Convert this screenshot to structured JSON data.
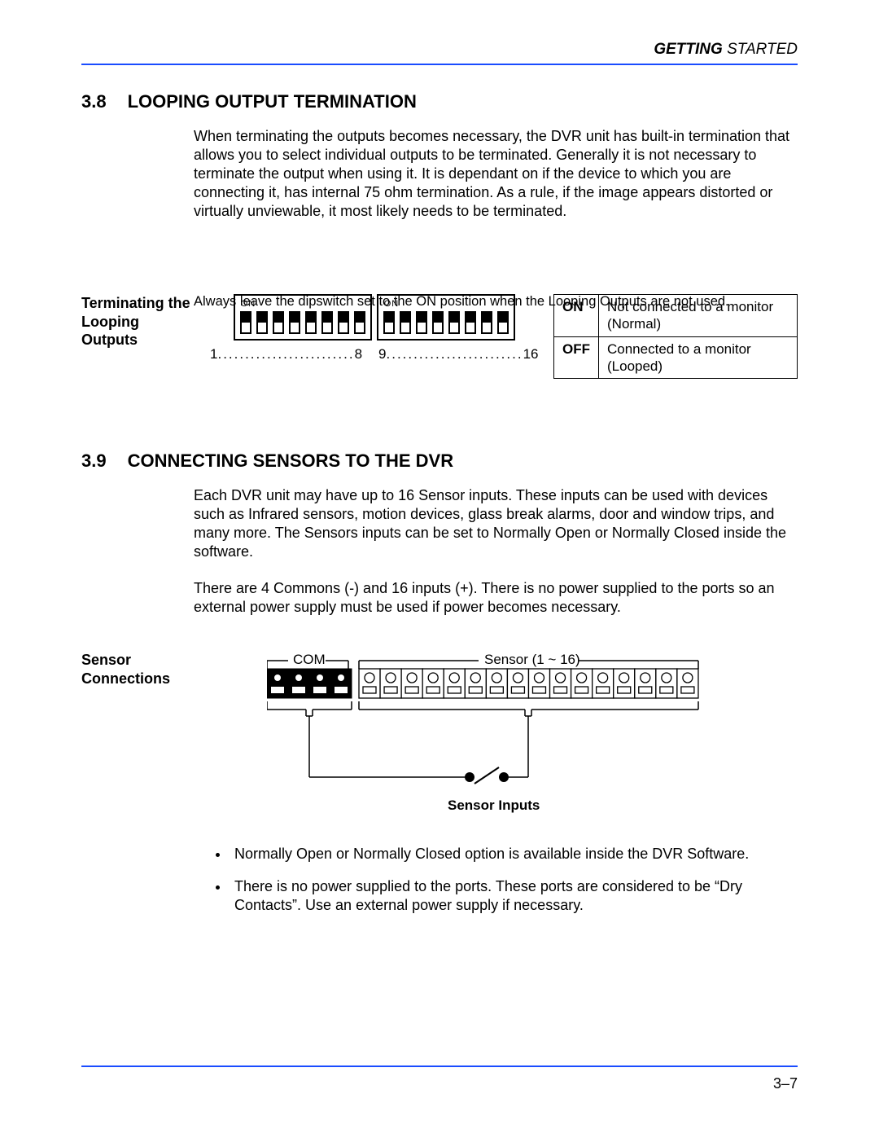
{
  "header": {
    "getting": "GETTING",
    "started": " STARTED"
  },
  "s38": {
    "num": "3.8",
    "title": "LOOPING OUTPUT TERMINATION",
    "body": "When terminating the outputs becomes necessary, the DVR unit has built-in termination that allows you to select individual outputs to be terminated. Generally it is not necessary to terminate the output when using it. It is dependant on if the device to which you are connecting it, has internal 75 ohm termination. As a rule, if the image appears distorted or virtually unviewable, it most likely needs to be terminated.",
    "side_label": "Terminating the Looping Outputs",
    "on_label": "ON",
    "range1_start": "1",
    "range1_end": "8",
    "range2_start": "9",
    "range2_end": "16",
    "table": {
      "on": "ON",
      "on_desc": "Not connected to a monitor (Normal)",
      "off": "OFF",
      "off_desc": "Connected to a monitor (Looped)"
    },
    "note": "Always leave the dipswitch set to the ON position when the Looping Outputs are not used."
  },
  "s39": {
    "num": "3.9",
    "title": "CONNECTING SENSORS TO THE DVR",
    "body1": "Each DVR unit may have up to 16 Sensor inputs. These inputs can be used with devices such as Infrared sensors, motion devices, glass break alarms, door and window trips, and many more. The Sensors inputs can be set to Normally Open or Normally Closed inside the software.",
    "body2": "There are 4 Commons (-) and 16 inputs (+). There is no power supplied to the ports so an external power supply must be used if power becomes necessary.",
    "side_label": "Sensor Connections",
    "diagram": {
      "com_label": "COM",
      "sensor_label": "Sensor (1 ~ 16)",
      "inputs_label": "Sensor Inputs"
    },
    "bullets": [
      "Normally Open or Normally Closed option is available inside the DVR Software.",
      "There is no power supplied to the ports. These ports are considered to be “Dry Contacts”. Use an external power supply if necessary."
    ]
  },
  "footer": {
    "page": "3–7"
  }
}
